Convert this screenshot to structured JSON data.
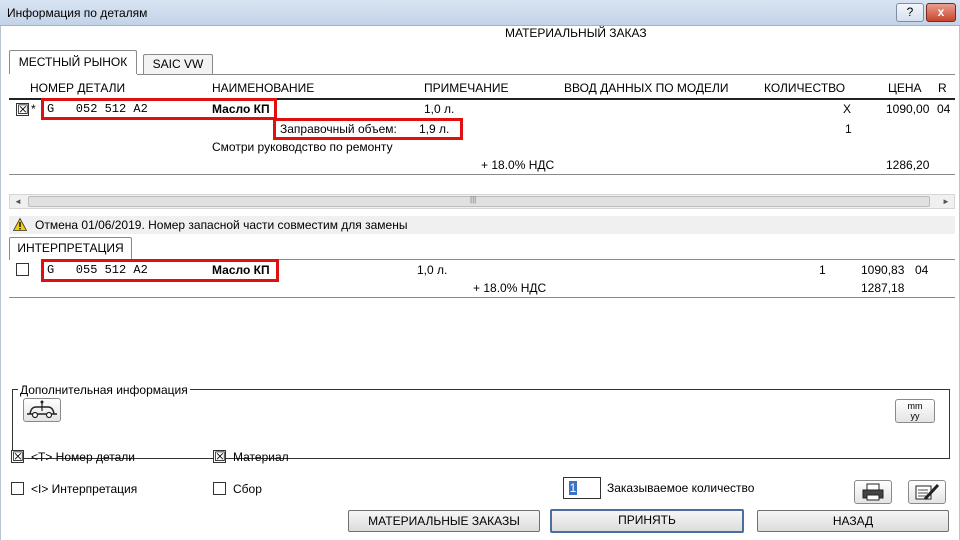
{
  "window": {
    "title": "Информация по деталям",
    "help_label": "?",
    "close_label": "x",
    "heading": "МАТЕРИАЛЬНЫЙ ЗАКАЗ"
  },
  "top_tabs": [
    "МЕСТНЫЙ РЫНОК",
    "SAIC VW"
  ],
  "columns": {
    "part_number": "НОМЕР ДЕТАЛИ",
    "name": "НАИМЕНОВАНИЕ",
    "note": "ПРИМЕЧАНИЕ",
    "model_input": "ВВОД ДАННЫХ ПО МОДЕЛИ",
    "quantity": "КОЛИЧЕСТВО",
    "price": "ЦЕНА",
    "r": "R"
  },
  "main_part": {
    "checked_mark": "☒",
    "star": "*",
    "part_number": "G   052 512 A2",
    "name": "Масло КП",
    "note": "1,0 л.",
    "qty_mark": "X",
    "price": "1090,00",
    "r": "04",
    "fill_label": "Заправочный объем:",
    "fill_value": "1,9 л.",
    "fill_qty": "1",
    "manual_note": "Смотри руководство по ремонту",
    "vat": "+ 18.0% НДС",
    "price_vat": "1286,20"
  },
  "scrollbar": {
    "left_arrow": "◄",
    "right_arrow": "►",
    "grip": "|||"
  },
  "warning": {
    "icon": "warning-icon",
    "text": "Отмена 01/06/2019. Номер запасной части совместим для замены"
  },
  "interpretation_tab": "ИНТЕРПРЕТАЦИЯ",
  "replacement_part": {
    "part_number": "G   055 512 A2",
    "name": "Масло КП",
    "note": "1,0 л.",
    "quantity": "1",
    "price": "1090,83",
    "r": "04",
    "vat": "+ 18.0% НДС",
    "price_vat": "1287,18"
  },
  "additional_info": {
    "label": "Дополнительная информация",
    "date_button": "mm/yy"
  },
  "options": {
    "part_number_label": "<T> Номер детали",
    "interpretation_label": "<I> Интерпретация",
    "material_label": "Материал",
    "assembly_label": "Сбор"
  },
  "order_qty": {
    "value": "1",
    "label": "Заказываемое количество"
  },
  "buttons": {
    "material_orders": "МАТЕРИАЛЬНЫЕ ЗАКАЗЫ",
    "accept": "ПРИНЯТЬ",
    "back": "НАЗАД"
  }
}
